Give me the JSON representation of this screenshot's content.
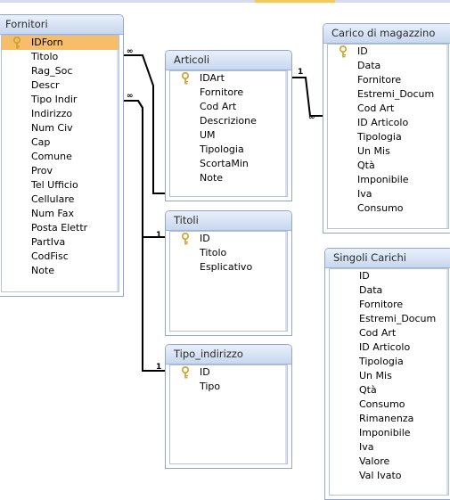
{
  "tables": {
    "fornitori": {
      "title": "Fornitori",
      "fields": [
        "IDForn",
        "Titolo",
        "Rag_Soc",
        "Descr",
        "Tipo Indir",
        "Indirizzo",
        "Num Civ",
        "Cap",
        "Comune",
        "Prov",
        "Tel Ufficio",
        "Cellulare",
        "Num Fax",
        "Posta Elettr",
        "PartIva",
        "CodFisc",
        "Note"
      ]
    },
    "articoli": {
      "title": "Articoli",
      "fields": [
        "IDArt",
        "Fornitore",
        "Cod Art",
        "Descrizione",
        "UM",
        "Tipologia",
        "ScortaMin",
        "Note"
      ]
    },
    "titoli": {
      "title": "Titoli",
      "fields": [
        "ID",
        "Titolo",
        "Esplicativo"
      ]
    },
    "tipo_indirizzo": {
      "title": "Tipo_indirizzo",
      "fields": [
        "ID",
        "Tipo"
      ]
    },
    "carico": {
      "title": "Carico di magazzino",
      "fields": [
        "ID",
        "Data",
        "Fornitore",
        "Estremi_Docum",
        "Cod Art",
        "ID Articolo",
        "Tipologia",
        "Un Mis",
        "Qtà",
        "Imponibile",
        "Iva",
        "Consumo"
      ]
    },
    "singoli": {
      "title": "Singoli Carichi",
      "fields": [
        "ID",
        "Data",
        "Fornitore",
        "Estremi_Docum",
        "Cod Art",
        "ID Articolo",
        "Tipologia",
        "Un Mis",
        "Qtà",
        "Consumo",
        "Rimanenza",
        "Imponibile",
        "Iva",
        "Valore",
        "Val Ivato"
      ]
    }
  },
  "relationships": [
    {
      "from": "fornitori",
      "to": "articoli",
      "one": "∞",
      "many": "1"
    },
    {
      "from": "fornitori",
      "to": "titoli",
      "one": "∞",
      "many": "1"
    },
    {
      "from": "fornitori",
      "to": "tipo_indirizzo",
      "one": "∞",
      "many": "1"
    },
    {
      "from": "articoli",
      "to": "carico",
      "one": "1",
      "many": "∞"
    }
  ],
  "cardinality": {
    "one": "1",
    "many": "∞"
  },
  "colors": {
    "selected": "#f6bd6b",
    "header": "#c8d7ee",
    "border": "#94a6c6",
    "key": "#c9a227"
  },
  "icons": {
    "primary_key": "key-icon"
  }
}
